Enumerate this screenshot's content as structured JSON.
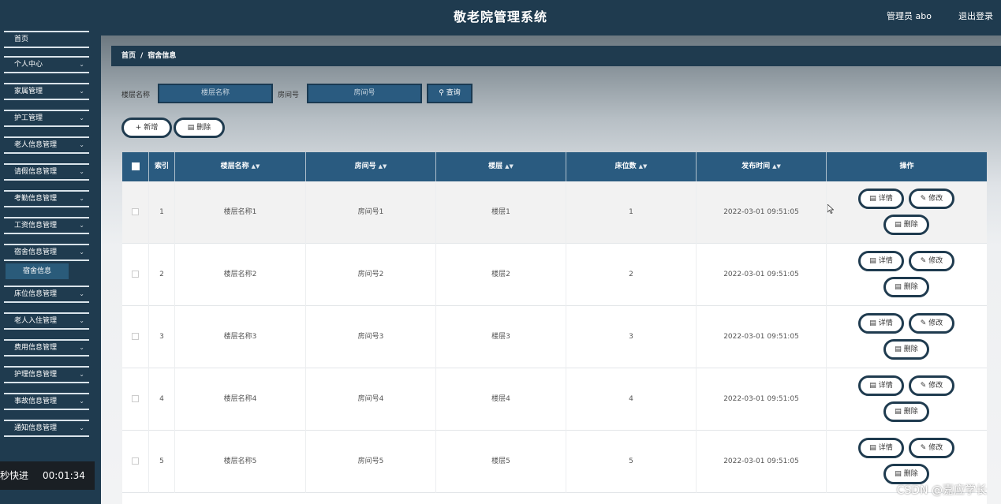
{
  "header": {
    "title": "敬老院管理系统",
    "user": "管理员 abo",
    "logout": "退出登录"
  },
  "sidebar": {
    "top_item": "首页",
    "items": [
      {
        "label": "个人中心"
      },
      {
        "label": "家属管理"
      },
      {
        "label": "护工管理"
      },
      {
        "label": "老人信息管理"
      },
      {
        "label": "请假信息管理"
      },
      {
        "label": "考勤信息管理"
      },
      {
        "label": "工资信息管理"
      },
      {
        "label": "宿舍信息管理"
      },
      {
        "label": "床位信息管理"
      },
      {
        "label": "老人入住管理"
      },
      {
        "label": "费用信息管理"
      },
      {
        "label": "护理信息管理"
      },
      {
        "label": "事故信息管理"
      },
      {
        "label": "通知信息管理"
      }
    ],
    "active_sub": "宿舍信息"
  },
  "overlay": {
    "speed": "秒快进",
    "time": "00:01:34"
  },
  "breadcrumb": {
    "home": "首页",
    "sep": "/",
    "current": "宿舍信息"
  },
  "search": {
    "floor_label": "楼层名称",
    "floor_placeholder": "楼层名称",
    "room_label": "房间号",
    "room_placeholder": "房间号",
    "query": "查询"
  },
  "actions": {
    "add": "新增",
    "delete": "删除"
  },
  "table": {
    "columns": [
      "索引",
      "楼层名称",
      "房间号",
      "楼层",
      "床位数",
      "发布时间",
      "操作"
    ],
    "rows": [
      {
        "index": "1",
        "floor_name": "楼层名称1",
        "room": "房间号1",
        "floor": "楼层1",
        "beds": "1",
        "time": "2022-03-01 09:51:05"
      },
      {
        "index": "2",
        "floor_name": "楼层名称2",
        "room": "房间号2",
        "floor": "楼层2",
        "beds": "2",
        "time": "2022-03-01 09:51:05"
      },
      {
        "index": "3",
        "floor_name": "楼层名称3",
        "room": "房间号3",
        "floor": "楼层3",
        "beds": "3",
        "time": "2022-03-01 09:51:05"
      },
      {
        "index": "4",
        "floor_name": "楼层名称4",
        "room": "房间号4",
        "floor": "楼层4",
        "beds": "4",
        "time": "2022-03-01 09:51:05"
      },
      {
        "index": "5",
        "floor_name": "楼层名称5",
        "room": "房间号5",
        "floor": "楼层5",
        "beds": "5",
        "time": "2022-03-01 09:51:05"
      }
    ],
    "row_actions": {
      "detail": "详情",
      "edit": "修改",
      "delete": "删除"
    }
  },
  "watermark": "CSDN @嘉应学长"
}
